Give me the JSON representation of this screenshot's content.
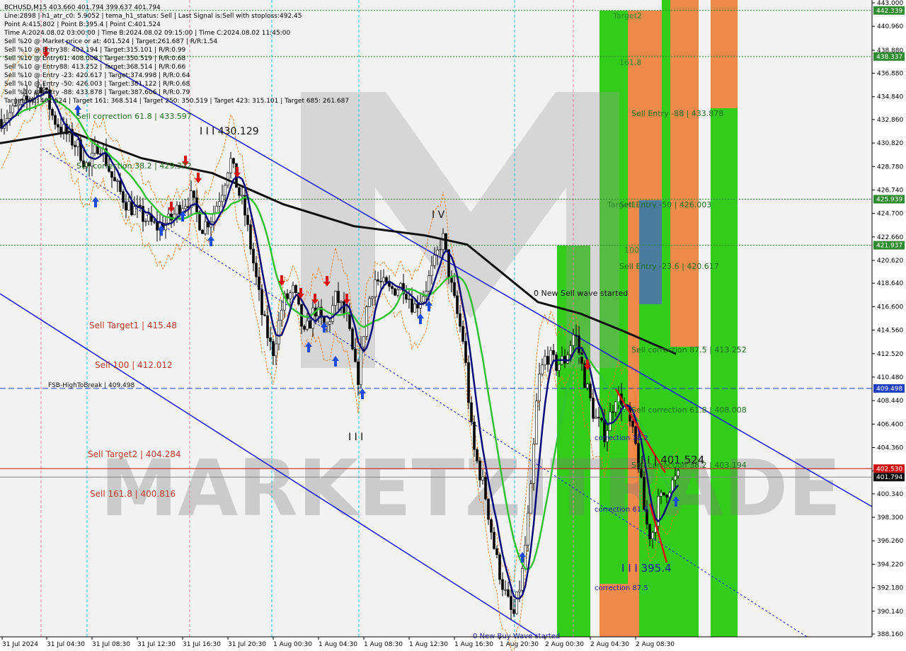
{
  "chart_data": {
    "type": "candlestick",
    "ylim": [
      388.16,
      443.0
    ],
    "info_lines": [
      "BCHUSD,M15  403.660 401.794 399.637 401.794",
      "Line:2898  |  h1_atr_c0: 5.9052  |  tema_h1_status: Sell  |  Last Signal is:Sell with stoploss:492.45",
      "Point A:415.802  |  Point B:395.4  |  Point C:401.524",
      "Time A:2024.08.02 03:00:00  |  Time B:2024.08.02 09:15:00  |  Time C:2024.08.02 11:45:00",
      "Sell %20 @ Market price or at: 401.524  |  Target:261.687  |  R/R:1.54",
      "Sell %10 @ Entry38: 403.194  |  Target:315.101  |  R/R:0.99",
      "Sell %10 @ Entry61: 408.008  |  Target:350.519  |  R/R:0.68",
      "Sell %10 @ Entry88: 413.252  |  Target:368.514  |  R/R:0.66",
      "Sell %10 @ Entry -23: 420.617  |  Target:374.998  |  R/R:0.64",
      "Sell %10 @ Entry -50: 426.003  |  Target:381.122  |  R/R:0.68",
      "Sell %10 @ Entry -88: 433.878  |  Target:387.606  |  R/R:0.79",
      "Target100: 401.524  |  Target 161: 368.514  |  Target 250: 350.519  |  Target 423: 315.101  |  Target 685: 261.687"
    ],
    "y_ticks": [
      "443.000",
      "440.960",
      "438.880",
      "436.880",
      "434.840",
      "432.860",
      "430.820",
      "428.780",
      "426.740",
      "424.700",
      "422.660",
      "420.620",
      "418.640",
      "416.600",
      "414.560",
      "412.520",
      "410.480",
      "408.440",
      "406.400",
      "404.360",
      "402.320",
      "400.340",
      "398.300",
      "396.260",
      "394.220",
      "392.180",
      "390.140",
      "388.160"
    ],
    "x_ticks": [
      "31 Jul 2024",
      "31 Jul 04:30",
      "31 Jul 08:30",
      "31 Jul 12:30",
      "31 Jul 16:30",
      "31 Jul 20:30",
      "1 Aug 00:30",
      "1 Aug 04:30",
      "1 Aug 08:30",
      "1 Aug 12:30",
      "1 Aug 16:30",
      "1 Aug 20:30",
      "2 Aug 00:30",
      "2 Aug 04:30",
      "2 Aug 08:30"
    ],
    "price_boxes": [
      {
        "value": 442.339,
        "label": "442.339",
        "color": "#2e8b2e"
      },
      {
        "value": 438.337,
        "label": "438.337",
        "color": "#2e8b2e"
      },
      {
        "value": 425.939,
        "label": "425.939",
        "color": "#2e8b2e"
      },
      {
        "value": 421.937,
        "label": "421.937",
        "color": "#2e8b2e"
      },
      {
        "value": 409.498,
        "label": "409.498",
        "color": "#1f3fbf"
      },
      {
        "value": 402.53,
        "label": "402.530",
        "color": "#d01010"
      },
      {
        "value": 401.794,
        "label": "401.794",
        "color": "#101010"
      }
    ],
    "horizontal_lines": [
      {
        "value": 442.339,
        "color": "#2e8b2e",
        "style": "dotted"
      },
      {
        "value": 438.337,
        "color": "#2e8b2e",
        "style": "dotted"
      },
      {
        "value": 425.939,
        "color": "#2e8b2e",
        "style": "dotted"
      },
      {
        "value": 421.937,
        "color": "#2e8b2e",
        "style": "dotted"
      },
      {
        "value": 409.498,
        "color": "#1f3fbf",
        "style": "dashed"
      },
      {
        "value": 402.53,
        "color": "#d01010",
        "style": "solid"
      },
      {
        "value": 401.794,
        "color": "#888888",
        "style": "solid"
      }
    ],
    "chart_labels": [
      {
        "text": "Target2",
        "color": "#2e8b2e"
      },
      {
        "text": "161.8",
        "color": "#2e8b2e"
      },
      {
        "text": "Sell Entry -88 | 433.878",
        "color": "#1e6e1e"
      },
      {
        "text": "Target1",
        "color": "#2e8b2e"
      },
      {
        "text": "Sell Entry -50 | 426.003",
        "color": "#1e6e1e"
      },
      {
        "text": "100",
        "color": "#2e8b2e"
      },
      {
        "text": "Sell Entry -23.6 | 420.617",
        "color": "#1e6e1e"
      },
      {
        "text": "Sell correction 87.5 | 413.252",
        "color": "#1e6e1e"
      },
      {
        "text": "Sell correction 61.8 | 408.008",
        "color": "#1e6e1e"
      },
      {
        "text": "Sell correction 38.2 | 403.194",
        "color": "#1e6e1e"
      },
      {
        "text": "Sell Target1 | 415.48",
        "color": "#c0392b"
      },
      {
        "text": "Sell 100 | 412.012",
        "color": "#c0392b"
      },
      {
        "text": "Sell Target2 | 404.284",
        "color": "#c0392b"
      },
      {
        "text": "Sell 161.8 | 400.816",
        "color": "#c0392b"
      },
      {
        "text": "FSB-HighToBreak | 409.498",
        "color": "#101010"
      },
      {
        "text": "Sell correction 61.8 | 433.597",
        "color": "#1e6e1e"
      },
      {
        "text": "Sell correction 38.2 | 429.322",
        "color": "#1e6e1e"
      },
      {
        "text": "I I I 430.129",
        "color": "#101010"
      },
      {
        "text": "I V",
        "color": "#101010"
      },
      {
        "text": "I I I",
        "color": "#101010"
      },
      {
        "text": "0 New Sell wave started",
        "color": "#101010"
      },
      {
        "text": "I I | 401.524",
        "color": "#101010"
      },
      {
        "text": "I I I 395.4",
        "color": "#1a1aa0"
      },
      {
        "text": "correction 38.2",
        "color": "#1a1aa0"
      },
      {
        "text": "correction 61.8",
        "color": "#1a1aa0"
      },
      {
        "text": "correction 87.5",
        "color": "#1a1aa0"
      },
      {
        "text": "0 New Buy Wave started",
        "color": "#1a1aa0"
      }
    ],
    "watermark": "MARKETZITRADE",
    "colors": {
      "green_zone": "#33cc1a",
      "orange_zone": "#f08a4b",
      "steel_zone": "#4a7c9e",
      "ma_black": "#101010",
      "ma_green": "#33c233",
      "ma_navy": "#0a0a7a",
      "channel_blue": "#1a1adf",
      "vline_cyan": "#22c6d8",
      "vline_pink": "#e87aa0",
      "down_arrow": "#e01010",
      "up_arrow": "#1a4ae0"
    }
  }
}
